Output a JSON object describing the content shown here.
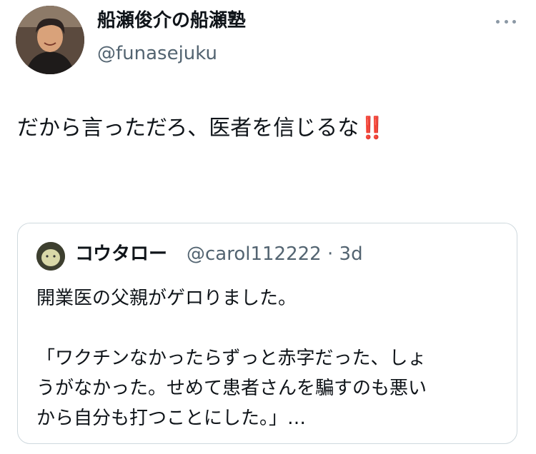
{
  "author": {
    "display_name": "船瀬俊介の船瀬塾",
    "handle": "@funasejuku",
    "avatar_icon": "user-avatar"
  },
  "menu": {
    "more_icon": "more-horizontal-icon"
  },
  "tweet": {
    "text": "だから言っただろ、医者を信じるな",
    "emoji": "‼️"
  },
  "quoted_tweet": {
    "display_name": "コウタロー",
    "meta": "@carol112222 · 3d",
    "avatar_icon": "user-avatar",
    "line1": "開業医の父親がゲロりました。",
    "line2": "「ワクチンなかったらずっと赤字だった、しょ",
    "line3": "うがなかった。せめて患者さんを騙すのも悪い",
    "line4": "から自分も打つことにした。」…"
  }
}
